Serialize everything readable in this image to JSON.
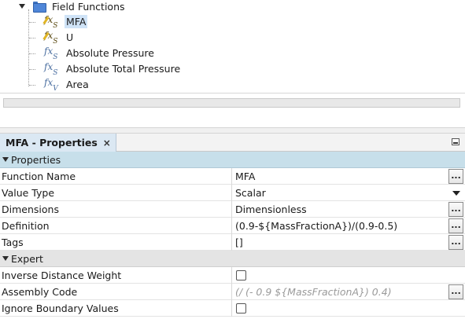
{
  "tree": {
    "folder_label": "Field Functions",
    "items": [
      {
        "label": "MFA",
        "icon": "user-field-function-scalar-icon",
        "selected": true
      },
      {
        "label": "U",
        "icon": "user-field-function-scalar-icon",
        "selected": false
      },
      {
        "label": "Absolute Pressure",
        "icon": "field-function-scalar-icon",
        "selected": false
      },
      {
        "label": "Absolute Total Pressure",
        "icon": "field-function-scalar-icon",
        "selected": false
      },
      {
        "label": "Area",
        "icon": "field-function-vector-icon",
        "selected": false
      }
    ]
  },
  "panel": {
    "tab_title": "MFA - Properties",
    "close_glyph": "×"
  },
  "properties": {
    "sections": [
      {
        "title": "Properties",
        "rows": [
          {
            "name": "Function Name",
            "value": "MFA",
            "editor": "ellipsis"
          },
          {
            "name": "Value Type",
            "value": "Scalar",
            "editor": "dropdown"
          },
          {
            "name": "Dimensions",
            "value": "Dimensionless",
            "editor": "ellipsis"
          },
          {
            "name": "Definition",
            "value": "(0.9-${MassFractionA})/(0.9-0.5)",
            "editor": "ellipsis"
          },
          {
            "name": "Tags",
            "value": "[]",
            "editor": "ellipsis"
          }
        ]
      },
      {
        "title": "Expert",
        "rows": [
          {
            "name": "Inverse Distance Weight",
            "checked": false,
            "editor": "checkbox"
          },
          {
            "name": "Assembly Code",
            "value": "(/ (- 0.9 ${MassFractionA}) 0.4)",
            "editor": "ellipsis",
            "disabled": true
          },
          {
            "name": "Ignore Boundary Values",
            "checked": false,
            "editor": "checkbox"
          }
        ]
      }
    ],
    "ellipsis_label": "..."
  },
  "colors": {
    "selection": "#cfe3f7",
    "section_header": "#c7dfea",
    "expert_header": "#e4e4e4",
    "tab_active": "#dbe8f3"
  }
}
